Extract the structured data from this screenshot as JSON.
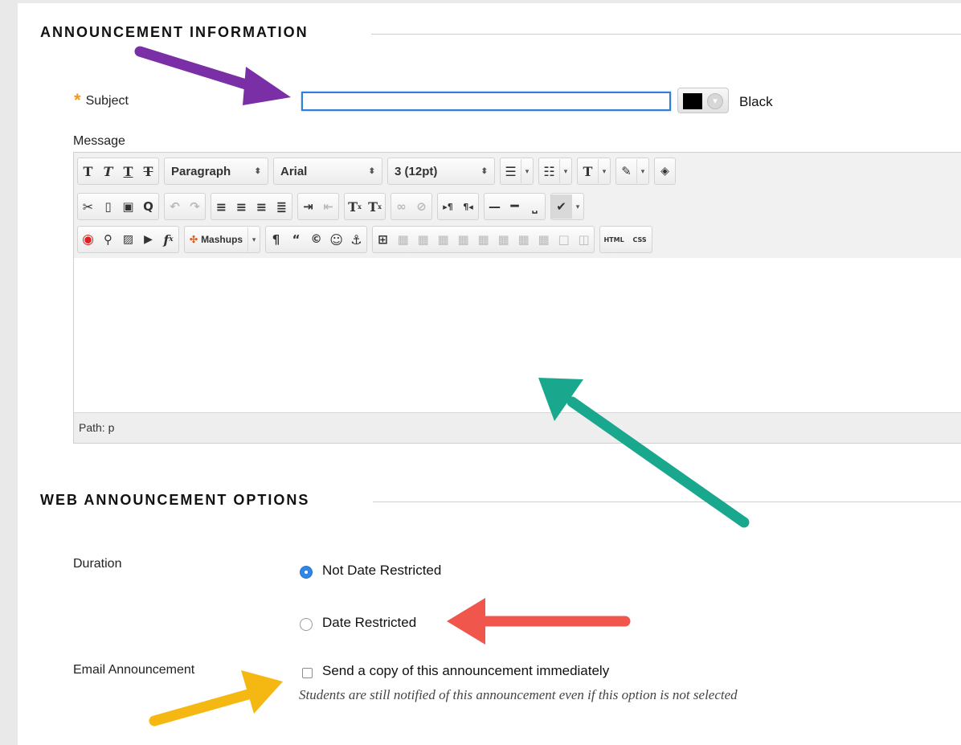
{
  "sections": {
    "announcement_info_title": "ANNOUNCEMENT INFORMATION",
    "web_options_title": "WEB ANNOUNCEMENT OPTIONS"
  },
  "subject": {
    "required_marker": "*",
    "label": "Subject",
    "value": "",
    "color_label": "Black",
    "color_value": "#000000"
  },
  "message": {
    "label": "Message",
    "toolbar": {
      "row1": {
        "format_icons": [
          "bold-icon",
          "italic-icon",
          "underline-icon",
          "strikethrough-icon"
        ],
        "paragraph_select": "Paragraph",
        "font_select": "Arial",
        "size_select": "3 (12pt)"
      },
      "row3": {
        "mashups_label": "Mashups",
        "html_label": "HTML",
        "css_label": "CSS"
      }
    },
    "body_text": "",
    "path_label": "Path:",
    "path_value": "p"
  },
  "options": {
    "duration_label": "Duration",
    "not_date_restricted": "Not Date Restricted",
    "date_restricted": "Date Restricted",
    "duration_selected": "Not Date Restricted",
    "email_label": "Email Announcement",
    "email_checkbox": "Send a copy of this announcement immediately",
    "email_checked": false,
    "email_hint": "Students are still notified of this announcement even if this option is not selected"
  },
  "annotation_colors": {
    "purple": "#7b2fa6",
    "teal": "#19a88e",
    "red": "#f0564b",
    "yellow": "#f5b712"
  },
  "accent": "#2f86e6"
}
